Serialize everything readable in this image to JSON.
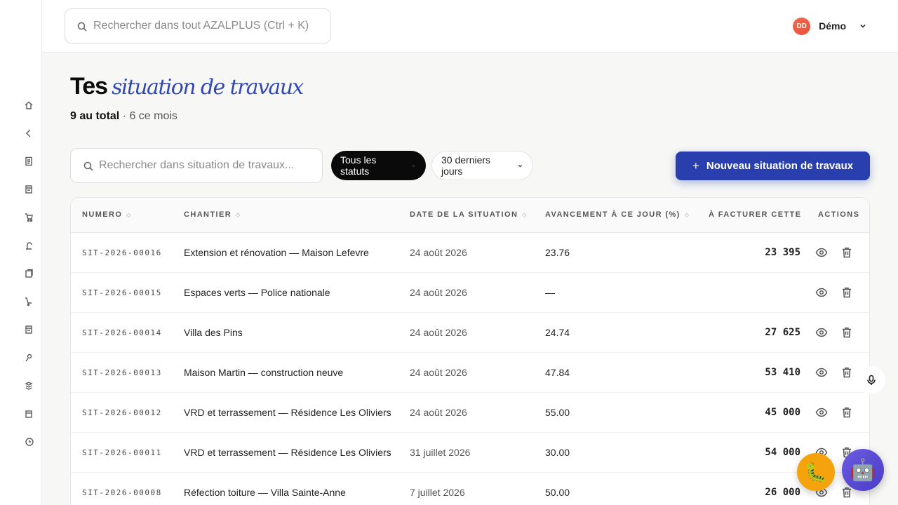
{
  "sidebar": {
    "icons": [
      "home-icon",
      "chevron-icon",
      "document-icon",
      "file-icon",
      "cart-icon",
      "tool-icon",
      "stack-icon",
      "truck-icon",
      "folder-icon",
      "user-icon",
      "layers-icon",
      "archive-icon",
      "clock-icon"
    ]
  },
  "header": {
    "search_placeholder": "Rechercher dans tout AZALPLUS (Ctrl + K)",
    "user_initials": "DD",
    "user_name": "Démo"
  },
  "page": {
    "title_strong": "Tes",
    "title_italic": "situation de travaux",
    "total_bold": "9 au total",
    "total_rest": " · 6 ce mois"
  },
  "filters": {
    "search_placeholder": "Rechercher dans situation de travaux...",
    "status_label": "Tous les statuts",
    "period_label": "30 derniers jours",
    "new_button_label": "Nouveau situation de travaux"
  },
  "table": {
    "columns": [
      "NUMERO",
      "CHANTIER",
      "DATE DE LA SITUATION",
      "AVANCEMENT À CE JOUR (%)",
      "À FACTURER CETTE",
      "ACTIONS"
    ],
    "rows": [
      {
        "numero": "SIT-2026-00016",
        "chantier": "Extension et rénovation — Maison Lefevre",
        "date": "24 août 2026",
        "avancement": "23.76",
        "facturer": "23 395"
      },
      {
        "numero": "SIT-2026-00015",
        "chantier": "Espaces verts — Police nationale",
        "date": "24 août 2026",
        "avancement": "—",
        "facturer": ""
      },
      {
        "numero": "SIT-2026-00014",
        "chantier": "Villa des Pins",
        "date": "24 août 2026",
        "avancement": "24.74",
        "facturer": "27 625"
      },
      {
        "numero": "SIT-2026-00013",
        "chantier": "Maison Martin — construction neuve",
        "date": "24 août 2026",
        "avancement": "47.84",
        "facturer": "53 410"
      },
      {
        "numero": "SIT-2026-00012",
        "chantier": "VRD et terrassement — Résidence Les Oliviers",
        "date": "24 août 2026",
        "avancement": "55.00",
        "facturer": "45 000"
      },
      {
        "numero": "SIT-2026-00011",
        "chantier": "VRD et terrassement — Résidence Les Oliviers",
        "date": "31 juillet 2026",
        "avancement": "30.00",
        "facturer": "54 000"
      },
      {
        "numero": "SIT-2026-00008",
        "chantier": "Réfection toiture — Villa Sainte-Anne",
        "date": "7 juillet 2026",
        "avancement": "50.00",
        "facturer": "26 000"
      }
    ]
  },
  "colors": {
    "accent": "#2a3fae",
    "title_italic": "#3048b8",
    "avatar": "#e8503a",
    "bug_fab": "#f4a30c",
    "bot_fab": "#5a4bd6"
  }
}
